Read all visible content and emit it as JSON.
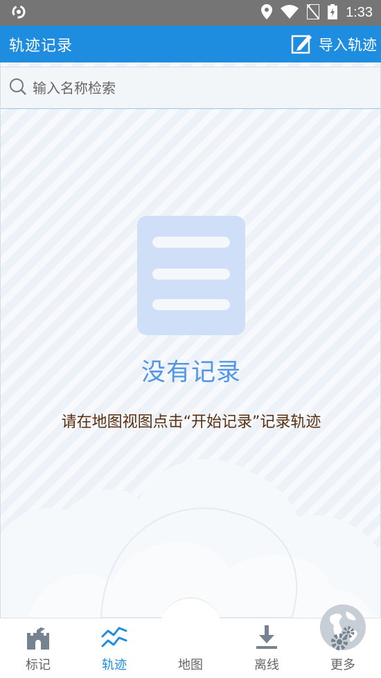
{
  "status_bar": {
    "time": "1:33"
  },
  "app_bar": {
    "title": "轨迹记录",
    "import_label": "导入轨迹"
  },
  "search": {
    "placeholder": "输入名称检索"
  },
  "empty_state": {
    "title": "没有记录",
    "hint": "请在地图视图点击“开始记录”记录轨迹"
  },
  "bottom_nav": {
    "items": [
      {
        "label": "标记",
        "icon": "castle-icon",
        "active": false
      },
      {
        "label": "轨迹",
        "icon": "track-icon",
        "active": true
      },
      {
        "label": "地图",
        "icon": "globe-icon",
        "active": false
      },
      {
        "label": "离线",
        "icon": "download-icon",
        "active": false
      },
      {
        "label": "更多",
        "icon": "gears-icon",
        "active": false
      }
    ]
  },
  "colors": {
    "status_bar": "#757575",
    "app_bar": "#1e8de0",
    "accent": "#1e8de0",
    "empty_title": "#5197e6",
    "empty_hint": "#5a3010",
    "content_bg": "#edf2f8"
  }
}
